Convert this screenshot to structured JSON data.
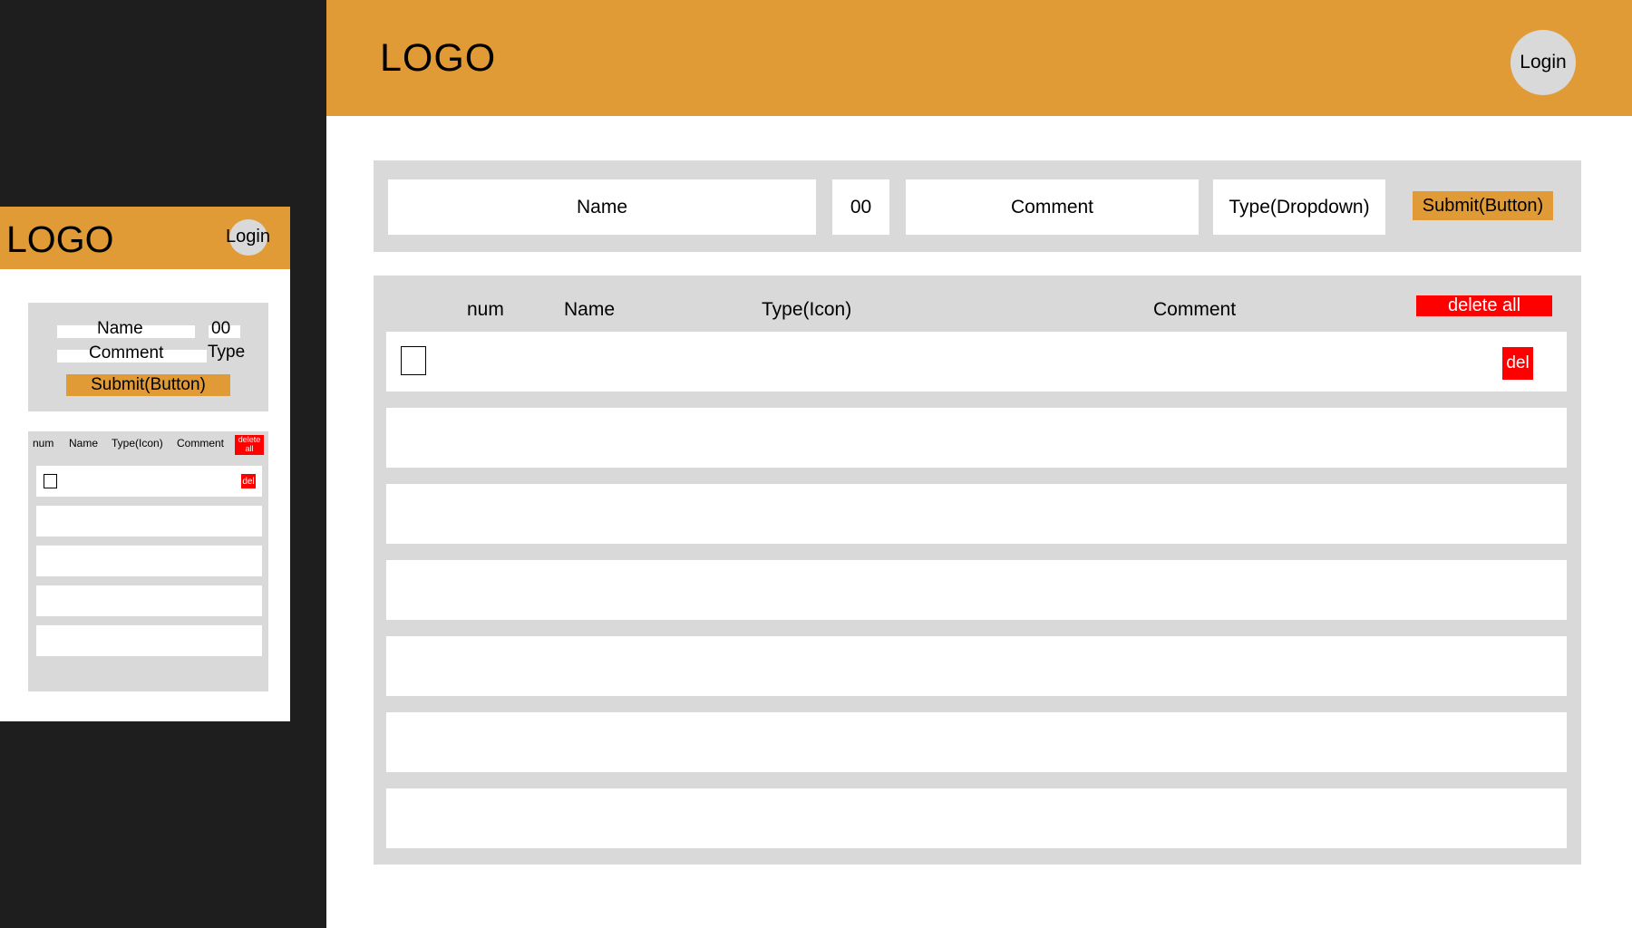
{
  "desktop": {
    "header": {
      "logo": "LOGO",
      "login_label": "Login"
    },
    "form": {
      "name_placeholder": "Name",
      "number_value": "00",
      "comment_placeholder": "Comment",
      "type_label": "Type(Dropdown)",
      "submit_label": "Submit(Button)"
    },
    "list": {
      "columns": {
        "num": "num",
        "name": "Name",
        "type": "Type(Icon)",
        "comment": "Comment"
      },
      "delete_all_label": "delete all",
      "first_row_delete_label": "del",
      "row_count": 7
    }
  },
  "mobile": {
    "header": {
      "logo": "LOGO",
      "login_label": "Login"
    },
    "form": {
      "name_placeholder": "Name",
      "number_value": "00",
      "comment_placeholder": "Comment",
      "type_label": "Type",
      "submit_label": "Submit(Button)"
    },
    "list": {
      "columns": {
        "num": "num",
        "name": "Name",
        "type": "Type(Icon)",
        "comment": "Comment"
      },
      "delete_all_label": "delete all",
      "first_row_delete_label": "del",
      "row_count": 5
    }
  },
  "colors": {
    "accent": "#e09b36",
    "panel": "#d9d9d9",
    "danger": "#ff0000",
    "background": "#1e1e1e"
  }
}
